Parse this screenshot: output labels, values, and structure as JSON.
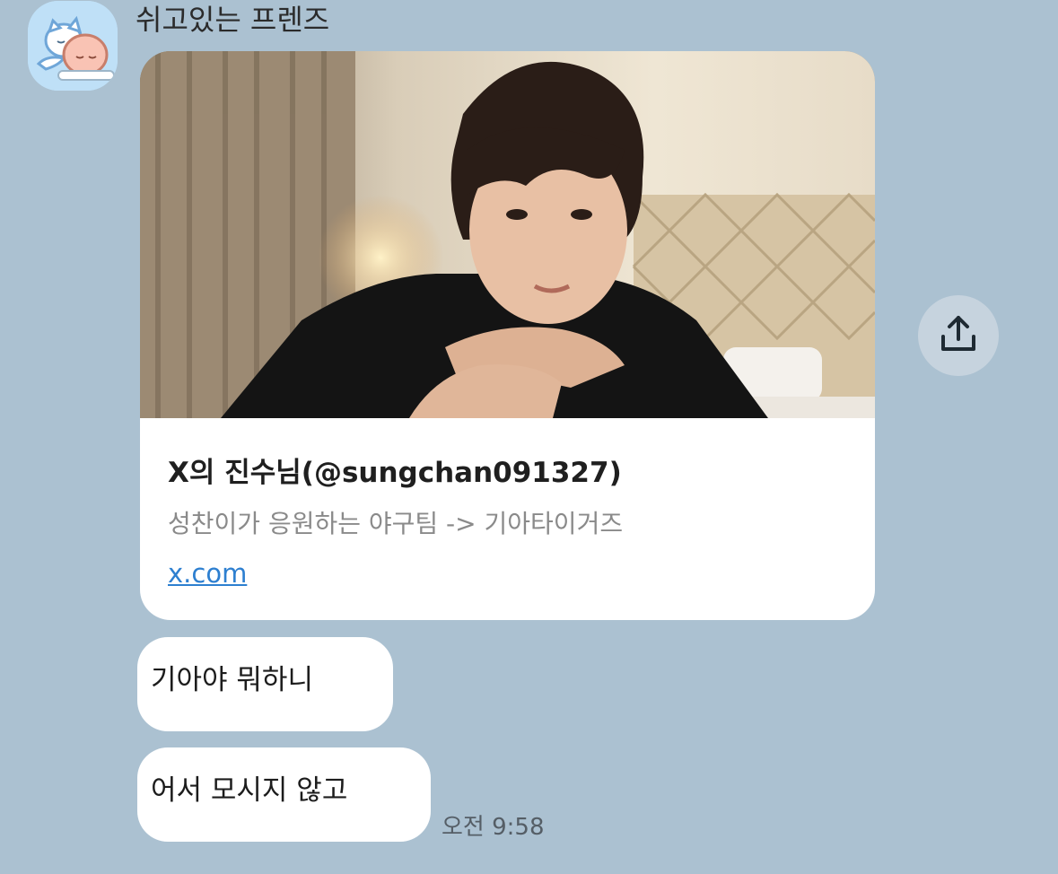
{
  "chat": {
    "sender_name": "쉬고있는 프렌즈",
    "avatar_icon": "sleeping-friends-avatar",
    "link_preview": {
      "title": "X의 진수님(@sungchan091327)",
      "description": "성찬이가 응원하는 야구팀 -> 기아타이거즈",
      "domain": "x.com",
      "image_icon": "profile-photo"
    },
    "share_icon": "share-upload-icon",
    "messages": [
      {
        "text": "기아야 뭐하니"
      },
      {
        "text": "어서 모시지 않고"
      }
    ],
    "timestamp": "오전 9:58"
  },
  "colors": {
    "background": "#abc1d1",
    "bubble": "#ffffff",
    "link": "#2d7fd0",
    "share_button": "#c6d3de"
  }
}
